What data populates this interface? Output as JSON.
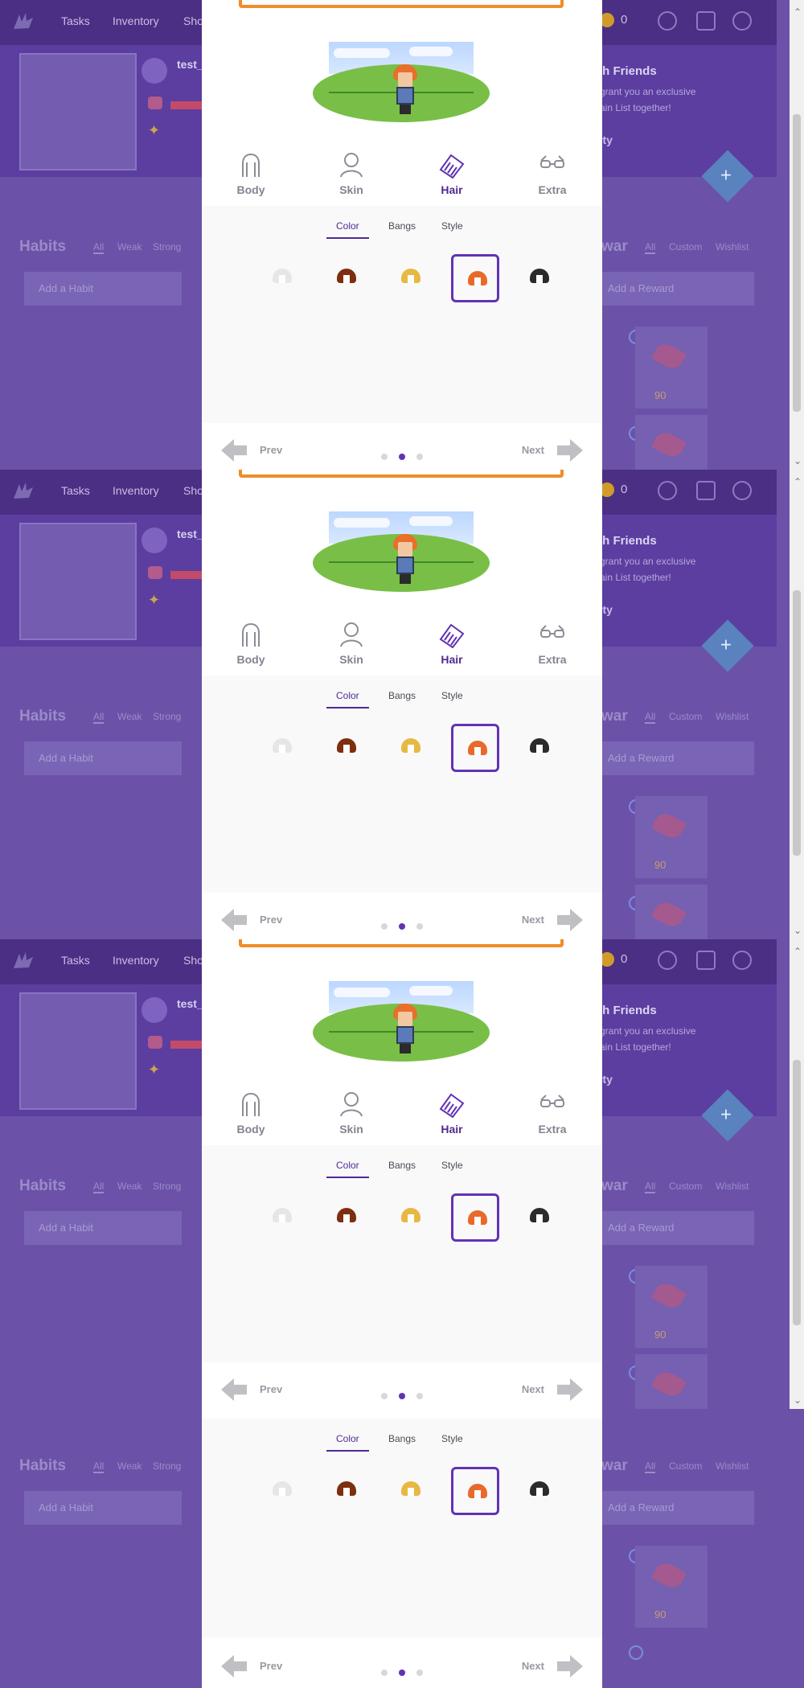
{
  "top_nav": {
    "tasks": "Tasks",
    "inventory": "Inventory",
    "shop": "Sho",
    "gold": "0"
  },
  "header": {
    "username": "test_",
    "friends_title": "ith Friends",
    "friends_line1": "grant you an exclusive",
    "friends_line2": "ain List together!",
    "party_word": "rty"
  },
  "lists": {
    "habits": "Habits",
    "filters_all": "All",
    "filters_weak": "Weak",
    "filters_strong": "Strong",
    "add_habit": "Add a Habit",
    "rewards": "war",
    "reward_all": "All",
    "reward_custom": "Custom",
    "reward_wishlist": "Wishlist",
    "add_reward": "Add a Reward",
    "price": "90"
  },
  "modal": {
    "tabs": [
      "Body",
      "Skin",
      "Hair",
      "Extra"
    ],
    "subtabs": [
      "Color",
      "Bangs",
      "Style"
    ],
    "prev": "Prev",
    "next": "Next",
    "swatch_colors": [
      "#e6e6e6",
      "#7d2f0f",
      "#e7b842",
      "#e86a2a",
      "#2b2b2b"
    ],
    "active_tab": "Hair",
    "active_subtab": "Color",
    "selected_swatch_index": 3,
    "current_page": 2,
    "total_pages": 3
  },
  "colors": {
    "accent": "#4f2a93",
    "selection": "#6133b4"
  }
}
